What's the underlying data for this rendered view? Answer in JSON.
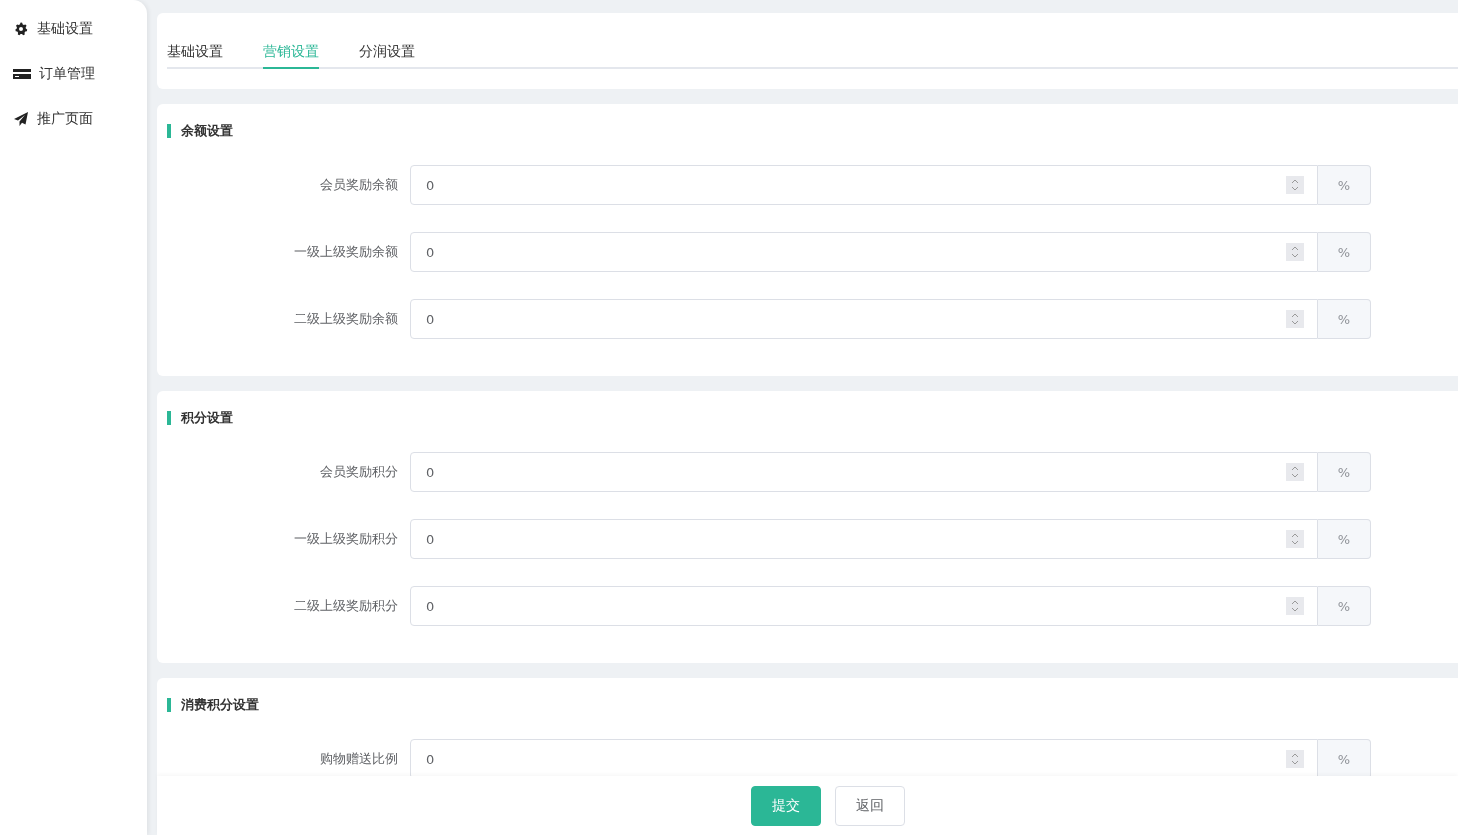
{
  "sidebar": {
    "items": [
      {
        "label": "基础设置",
        "selected": false
      },
      {
        "label": "订单管理",
        "selected": false
      },
      {
        "label": "推广页面",
        "selected": false
      }
    ]
  },
  "tabs": [
    {
      "label": "基础设置",
      "selected": false
    },
    {
      "label": "营销设置",
      "selected": true
    },
    {
      "label": "分润设置",
      "selected": false
    }
  ],
  "sections": [
    {
      "title": "余额设置",
      "fields": [
        {
          "label": "会员奖励余额",
          "value": "0",
          "unit": "%"
        },
        {
          "label": "一级上级奖励余额",
          "value": "0",
          "unit": "%"
        },
        {
          "label": "二级上级奖励余额",
          "value": "0",
          "unit": "%"
        }
      ]
    },
    {
      "title": "积分设置",
      "fields": [
        {
          "label": "会员奖励积分",
          "value": "0",
          "unit": "%"
        },
        {
          "label": "一级上级奖励积分",
          "value": "0",
          "unit": "%"
        },
        {
          "label": "二级上级奖励积分",
          "value": "0",
          "unit": "%"
        }
      ]
    },
    {
      "title": "消费积分设置",
      "fields": [
        {
          "label": "购物赠送比例",
          "value": "0",
          "unit": "%"
        }
      ]
    }
  ],
  "footer": {
    "buttons": [
      {
        "label": "提交",
        "kind": "primary"
      },
      {
        "label": "返回",
        "kind": "default"
      }
    ]
  }
}
